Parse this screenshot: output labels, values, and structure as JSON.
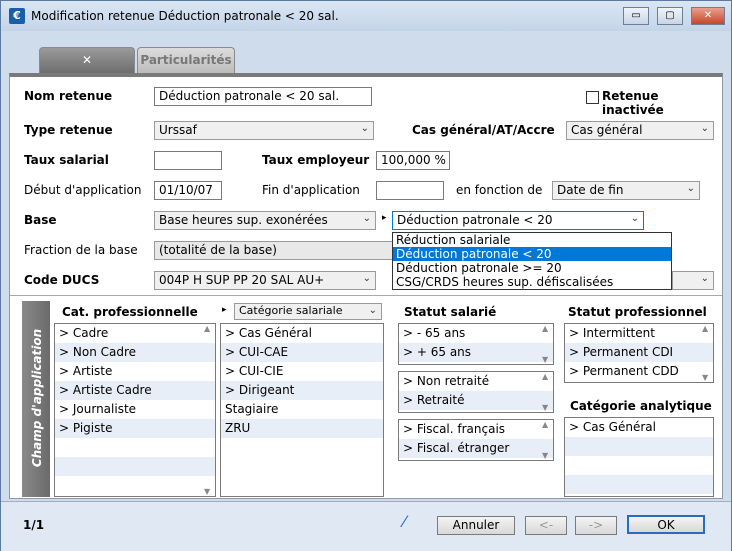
{
  "window": {
    "title": "Modification retenue Déduction patronale < 20 sal.",
    "icon": "€",
    "min": "▭",
    "max": "▢",
    "close": "✕"
  },
  "tabs": [
    {
      "label": "✕"
    },
    {
      "label": "Particularités"
    }
  ],
  "form": {
    "nom_label": "Nom retenue",
    "nom_value": "Déduction patronale < 20 sal.",
    "inactive_label": "Retenue inactivée",
    "type_label": "Type retenue",
    "type_value": "Urssaf",
    "cas_label": "Cas général/AT/Accre",
    "cas_value": "Cas général",
    "taux_sal_label": "Taux salarial",
    "taux_sal_value": "",
    "taux_emp_label": "Taux employeur",
    "taux_emp_value": "100,000 %",
    "debut_label": "Début d'application",
    "debut_value": "01/10/07",
    "fin_label": "Fin d'application",
    "fin_value": "",
    "fonction_label": "en fonction de",
    "fonction_value": "Date de fin",
    "base_label": "Base",
    "base_value": "Base heures sup. exonérées",
    "base2_value": "Déduction patronale < 20",
    "fraction_label": "Fraction de la base",
    "fraction_value": "(totalité de la base)",
    "ducs_label": "Code DUCS",
    "ducs_value": "004P   H SUP PP 20 SAL AU+"
  },
  "dropdown": {
    "options": [
      "Réduction salariale",
      "Déduction patronale < 20",
      "Déduction patronale >= 20",
      "CSG/CRDS heures sup. défiscalisées"
    ]
  },
  "champ": {
    "vtab_label": "Champ d'application",
    "cat_pro_header": "Cat. professionnelle",
    "cat_pro": [
      "> Cadre",
      "> Non Cadre",
      "> Artiste",
      "> Artiste Cadre",
      "> Journaliste",
      "> Pigiste"
    ],
    "cat_sal_combo": "Catégorie salariale",
    "cat_sal": [
      "> Cas Général",
      "> CUI-CAE",
      "> CUI-CIE",
      "> Dirigeant",
      "  Stagiaire",
      "  ZRU"
    ],
    "statut_sal_header": "Statut salarié",
    "age": [
      ">  - 65 ans",
      ">  + 65 ans"
    ],
    "retraite": [
      "> Non retraité",
      "> Retraité"
    ],
    "fiscal": [
      "> Fiscal. français",
      "> Fiscal. étranger"
    ],
    "statut_pro_header": "Statut professionnel",
    "statut_pro": [
      "> Intermittent",
      "> Permanent CDI",
      "> Permanent CDD"
    ],
    "analytique_header": "Catégorie analytique",
    "analytique": [
      "> Cas Général"
    ]
  },
  "footer": {
    "page": "1/1",
    "annuler": "Annuler",
    "prev": "<-",
    "next": "->",
    "ok": "OK"
  }
}
